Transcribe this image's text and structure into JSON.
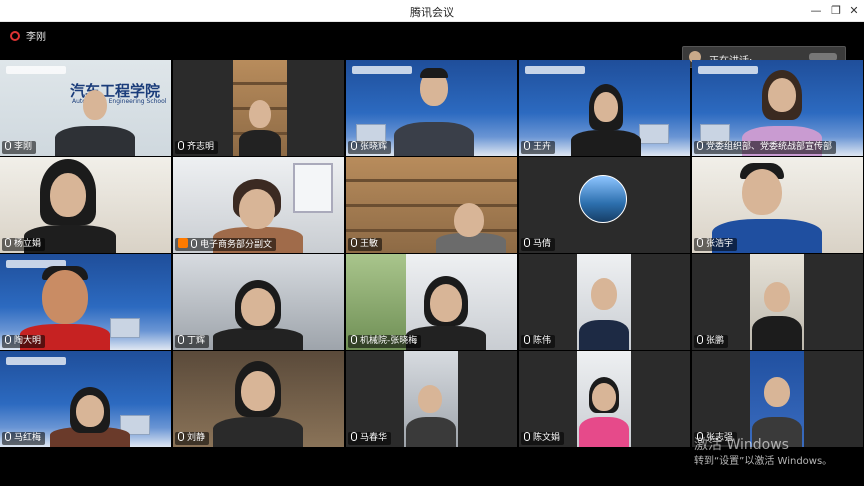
{
  "window": {
    "title": "腾讯会议"
  },
  "top": {
    "host_label": "李刚",
    "speaker_view_label": "正在讲话:"
  },
  "tiles": [
    {
      "name": "李刚",
      "mic": "on"
    },
    {
      "name": "齐志明",
      "mic": "on"
    },
    {
      "name": "张晓辉",
      "mic": "on"
    },
    {
      "name": "王卉",
      "mic": "on"
    },
    {
      "name": "党委组织部、党委统战部宣传部",
      "mic": "on"
    },
    {
      "name": "杨立娟",
      "mic": "on"
    },
    {
      "name": "电子商务部分副文",
      "mic": "on",
      "badge": true
    },
    {
      "name": "王敏",
      "mic": "on"
    },
    {
      "name": "马倩",
      "mic": "on"
    },
    {
      "name": "张浩宇",
      "mic": "on"
    },
    {
      "name": "陶大明",
      "mic": "on"
    },
    {
      "name": "丁辉",
      "mic": "on"
    },
    {
      "name": "机械院-张晓梅",
      "mic": "on"
    },
    {
      "name": "陈伟",
      "mic": "on"
    },
    {
      "name": "张鹏",
      "mic": "on"
    },
    {
      "name": "马红梅",
      "mic": "on"
    },
    {
      "name": "刘静",
      "mic": "on"
    },
    {
      "name": "马春华",
      "mic": "on"
    },
    {
      "name": "陈文娟",
      "mic": "on"
    },
    {
      "name": "张志强",
      "mic": "on"
    }
  ],
  "signboard": {
    "chinese": "汽车工程学院",
    "english": "Automotive Engineering School"
  },
  "watermark": {
    "line1": "激活 Windows",
    "line2": "转到“设置”以激活 Windows。"
  }
}
